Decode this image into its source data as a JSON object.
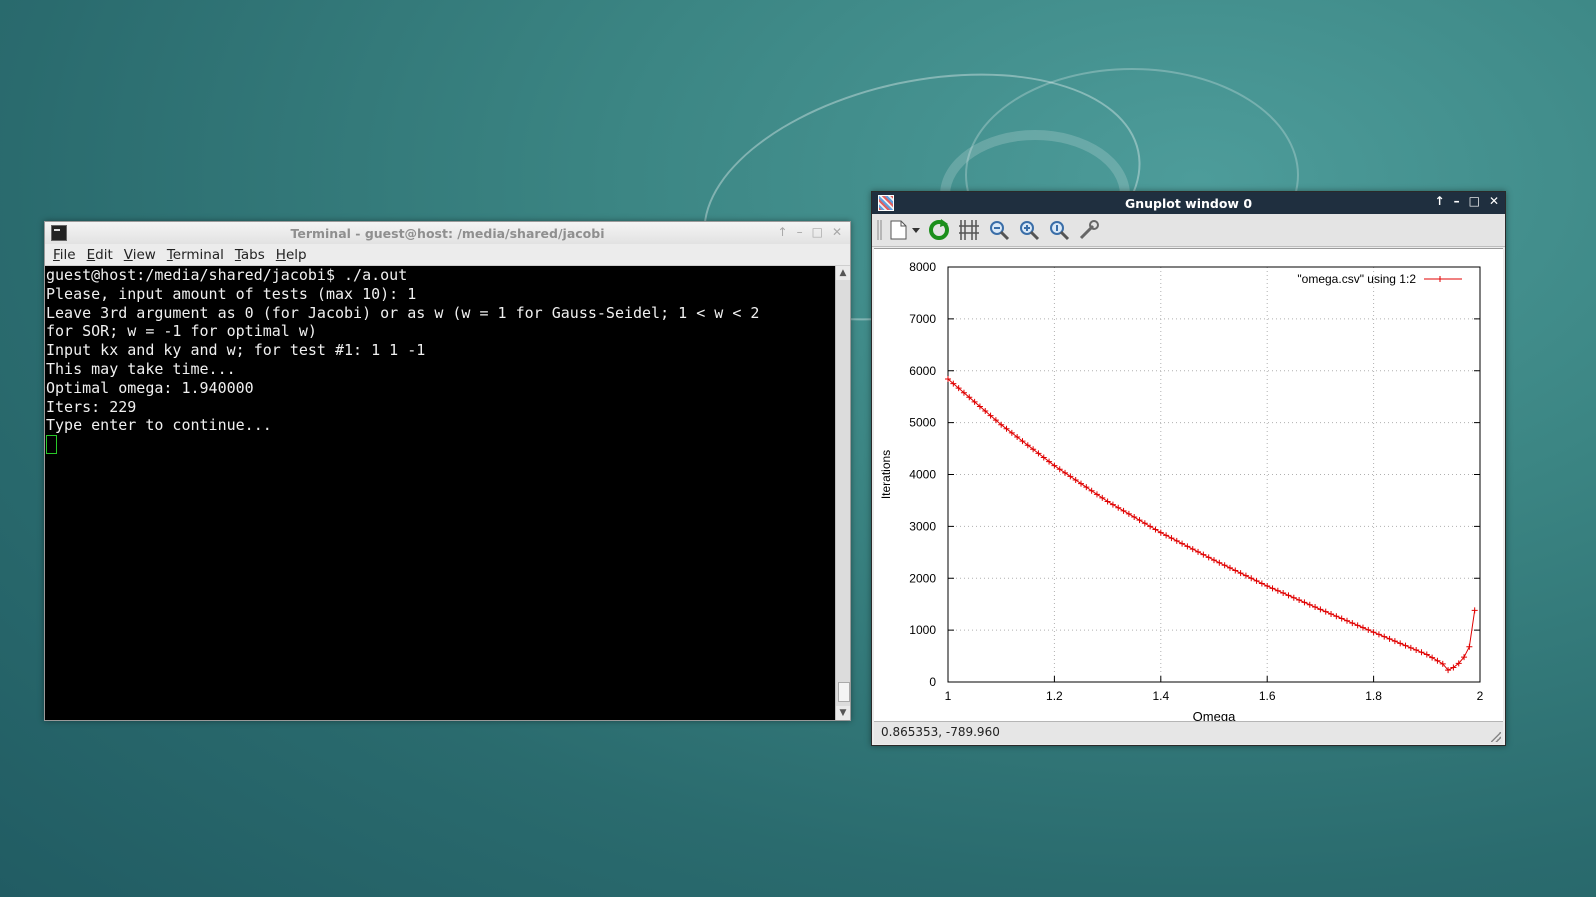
{
  "terminal": {
    "title": "Terminal - guest@host: /media/shared/jacobi",
    "menu": [
      "File",
      "Edit",
      "View",
      "Terminal",
      "Tabs",
      "Help"
    ],
    "lines": [
      "guest@host:/media/shared/jacobi$ ./a.out",
      "Please, input amount of tests (max 10): 1",
      "Leave 3rd argument as 0 (for Jacobi) or as w (w = 1 for Gauss-Seidel; 1 < w < 2",
      "for SOR; w = -1 for optimal w)",
      "Input kx and ky and w; for test #1: 1 1 -1",
      "This may take time...",
      "Optimal omega: 1.940000",
      "Iters: 229",
      "Type enter to continue..."
    ]
  },
  "gnuplot": {
    "title": "Gnuplot window 0",
    "status": "0.865353, -789.960",
    "toolbar_icons": [
      "export-icon",
      "replot-icon",
      "grid-icon",
      "zoom-out-icon",
      "zoom-in-icon",
      "unzoom-icon",
      "config-icon"
    ]
  },
  "chart_data": {
    "type": "line",
    "title": "",
    "xlabel": "Omega",
    "ylabel": "Iterations",
    "xlim": [
      1,
      2
    ],
    "ylim": [
      0,
      8000
    ],
    "xticks": [
      "1",
      "1.2",
      "1.4",
      "1.6",
      "1.8",
      "2"
    ],
    "yticks": [
      "0",
      "1000",
      "2000",
      "3000",
      "4000",
      "5000",
      "6000",
      "7000",
      "8000"
    ],
    "grid": true,
    "legend_position": "top-right",
    "series": [
      {
        "name": "\"omega.csv\" using 1:2",
        "color": "#e00000",
        "marker": "plus",
        "x": [
          1.0,
          1.1,
          1.2,
          1.3,
          1.4,
          1.5,
          1.6,
          1.7,
          1.8,
          1.9,
          1.93,
          1.94,
          1.95,
          1.96,
          1.97,
          1.98,
          1.99
        ],
        "y": [
          5840,
          4960,
          4170,
          3480,
          2880,
          2350,
          1850,
          1400,
          960,
          530,
          350,
          229,
          280,
          360,
          480,
          680,
          1380
        ]
      }
    ]
  }
}
